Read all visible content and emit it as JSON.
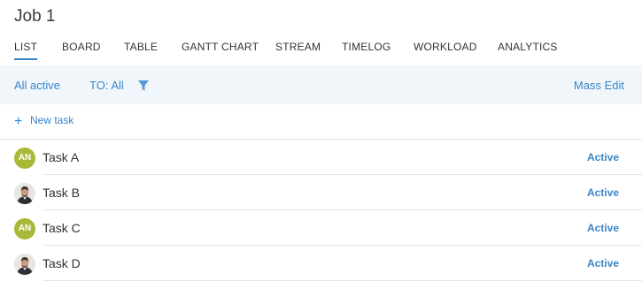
{
  "page": {
    "title": "Job 1"
  },
  "tabs": [
    {
      "label": "LIST",
      "active": true
    },
    {
      "label": "BOARD"
    },
    {
      "label": "TABLE"
    },
    {
      "label": "GANTT CHART"
    },
    {
      "label": "STREAM"
    },
    {
      "label": "TIMELOG"
    },
    {
      "label": "WORKLOAD"
    },
    {
      "label": "ANALYTICS"
    }
  ],
  "filterbar": {
    "status_filter": "All active",
    "assignee_filter": "TO: All",
    "filter_icon": "funnel-icon",
    "mass_edit": "Mass Edit"
  },
  "new_task": {
    "label": "New task",
    "icon": "plus-icon"
  },
  "tasks": [
    {
      "name": "Task A",
      "status": "Active",
      "assignee_initials": "AN",
      "avatar": "initials"
    },
    {
      "name": "Task B",
      "status": "Active",
      "assignee_initials": "",
      "avatar": "photo"
    },
    {
      "name": "Task C",
      "status": "Active",
      "assignee_initials": "AN",
      "avatar": "initials"
    },
    {
      "name": "Task D",
      "status": "Active",
      "assignee_initials": "",
      "avatar": "photo"
    }
  ],
  "colors": {
    "accent": "#3a86c8",
    "filterbar_bg": "#f1f6fb",
    "avatar_initials_bg": "#a9b836"
  }
}
